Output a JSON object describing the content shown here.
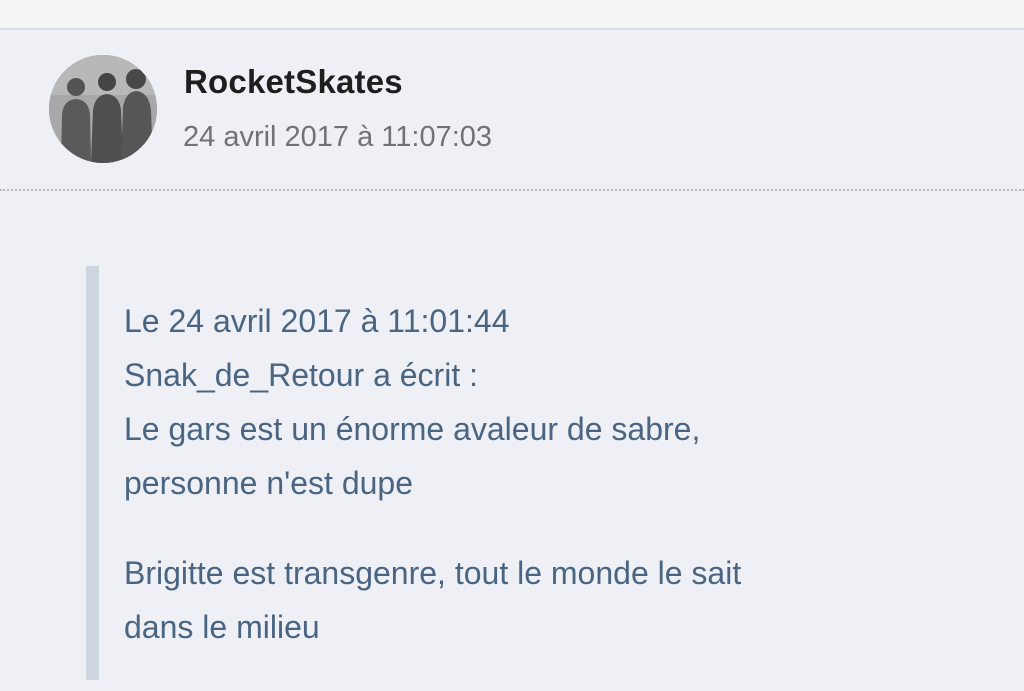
{
  "post": {
    "author": "RocketSkates",
    "timestamp": "24 avril 2017 à 11:07:03",
    "avatar": {
      "icon": "group-photo-avatar"
    },
    "quote": {
      "header_date": "Le 24 avril 2017 à 11:01:44",
      "header_author": "Snak_de_Retour a écrit :",
      "quoted_lines": [
        "Le gars est un énorme avaleur de sabre,",
        "personne n'est dupe"
      ],
      "reply_lines": [
        "Brigitte est transgenre, tout le monde le sait",
        "dans le milieu"
      ]
    }
  },
  "colors": {
    "background": "#eef0f5",
    "author_text": "#1e1e1e",
    "timestamp_text": "#6f7378",
    "quote_text": "#4a6582",
    "quote_bar": "#cdd5de"
  }
}
